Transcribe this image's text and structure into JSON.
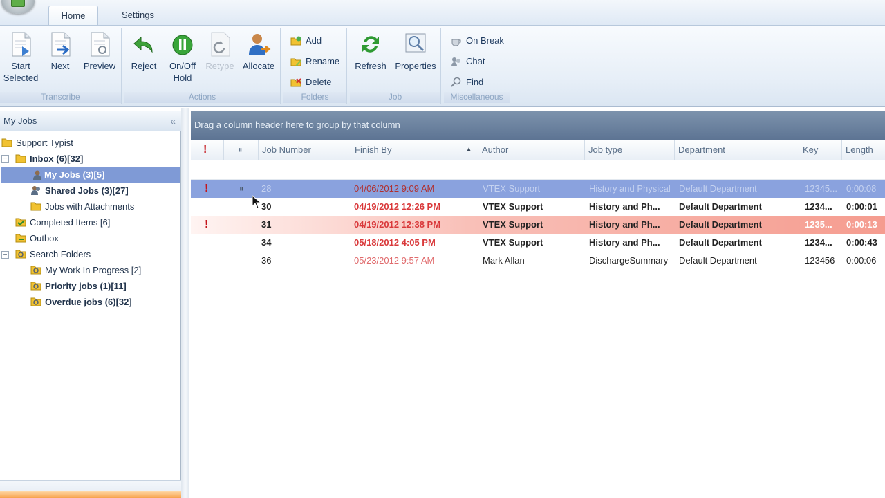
{
  "tabs": [
    {
      "label": "Home"
    },
    {
      "label": "Settings"
    }
  ],
  "ribbon": {
    "groups": {
      "transcribe": "Transcribe",
      "actions": "Actions",
      "folders": "Folders",
      "job": "Job",
      "miscellaneous": "Miscellaneous"
    },
    "buttons": {
      "start_selected": "Start Selected",
      "next": "Next",
      "preview": "Preview",
      "reject": "Reject",
      "onoff_hold": "On/Off Hold",
      "retype": "Retype",
      "allocate": "Allocate",
      "add": "Add",
      "rename": "Rename",
      "delete": "Delete",
      "refresh": "Refresh",
      "properties": "Properties",
      "on_break": "On Break",
      "chat": "Chat",
      "find": "Find"
    }
  },
  "left_panel": {
    "title": "My Jobs",
    "collapse": "«",
    "tree": {
      "support_typist": "Support Typist",
      "inbox": "Inbox (6)[32]",
      "my_jobs": "My Jobs (3)[5]",
      "shared_jobs": "Shared Jobs (3)[27]",
      "jobs_with_attachments": "Jobs with Attachments",
      "completed_items": "Completed Items [6]",
      "outbox": "Outbox",
      "search_folders": "Search Folders",
      "my_work_in_progress": "My Work In Progress [2]",
      "priority_jobs": "Priority jobs (1)[11]",
      "overdue_jobs": "Overdue jobs (6)[32]"
    }
  },
  "grid": {
    "group_hint": "Drag a column header here to group by that column",
    "columns": {
      "priority": "!",
      "attachment": "⏸",
      "job_number": "Job Number",
      "finish_by": "Finish By",
      "author": "Author",
      "job_type": "Job type",
      "department": "Department",
      "key": "Key",
      "length": "Length"
    },
    "rows": [
      {
        "priority": "!",
        "attachment": "⏸",
        "job_number": "28",
        "finish_by": "04/06/2012 9:09 AM",
        "author": "VTEX Support",
        "job_type": "History and Physical",
        "department": "Default Department",
        "key": "12345...",
        "length": "0:00:08"
      },
      {
        "priority": "",
        "attachment": "",
        "job_number": "30",
        "finish_by": "04/19/2012 12:26 PM",
        "author": "VTEX Support",
        "job_type": "History and Ph...",
        "department": "Default Department",
        "key": "1234...",
        "length": "0:00:01"
      },
      {
        "priority": "!",
        "attachment": "",
        "job_number": "31",
        "finish_by": "04/19/2012 12:38 PM",
        "author": "VTEX Support",
        "job_type": "History and Ph...",
        "department": "Default Department",
        "key": "1235...",
        "length": "0:00:13"
      },
      {
        "priority": "",
        "attachment": "",
        "job_number": "34",
        "finish_by": "05/18/2012 4:05 PM",
        "author": "VTEX Support",
        "job_type": "History and Ph...",
        "department": "Default Department",
        "key": "1234...",
        "length": "0:00:43"
      },
      {
        "priority": "",
        "attachment": "",
        "job_number": "36",
        "finish_by": "05/23/2012 9:57 AM",
        "author": "Mark Allan",
        "job_type": "DischargeSummary",
        "department": "Default Department",
        "key": "123456",
        "length": "0:00:06"
      }
    ]
  },
  "colors": {
    "selected_row": "#8aa2de",
    "priority_row": "#f59c8f",
    "date_red": "#d9383a",
    "header_bar": "#5d7493"
  }
}
